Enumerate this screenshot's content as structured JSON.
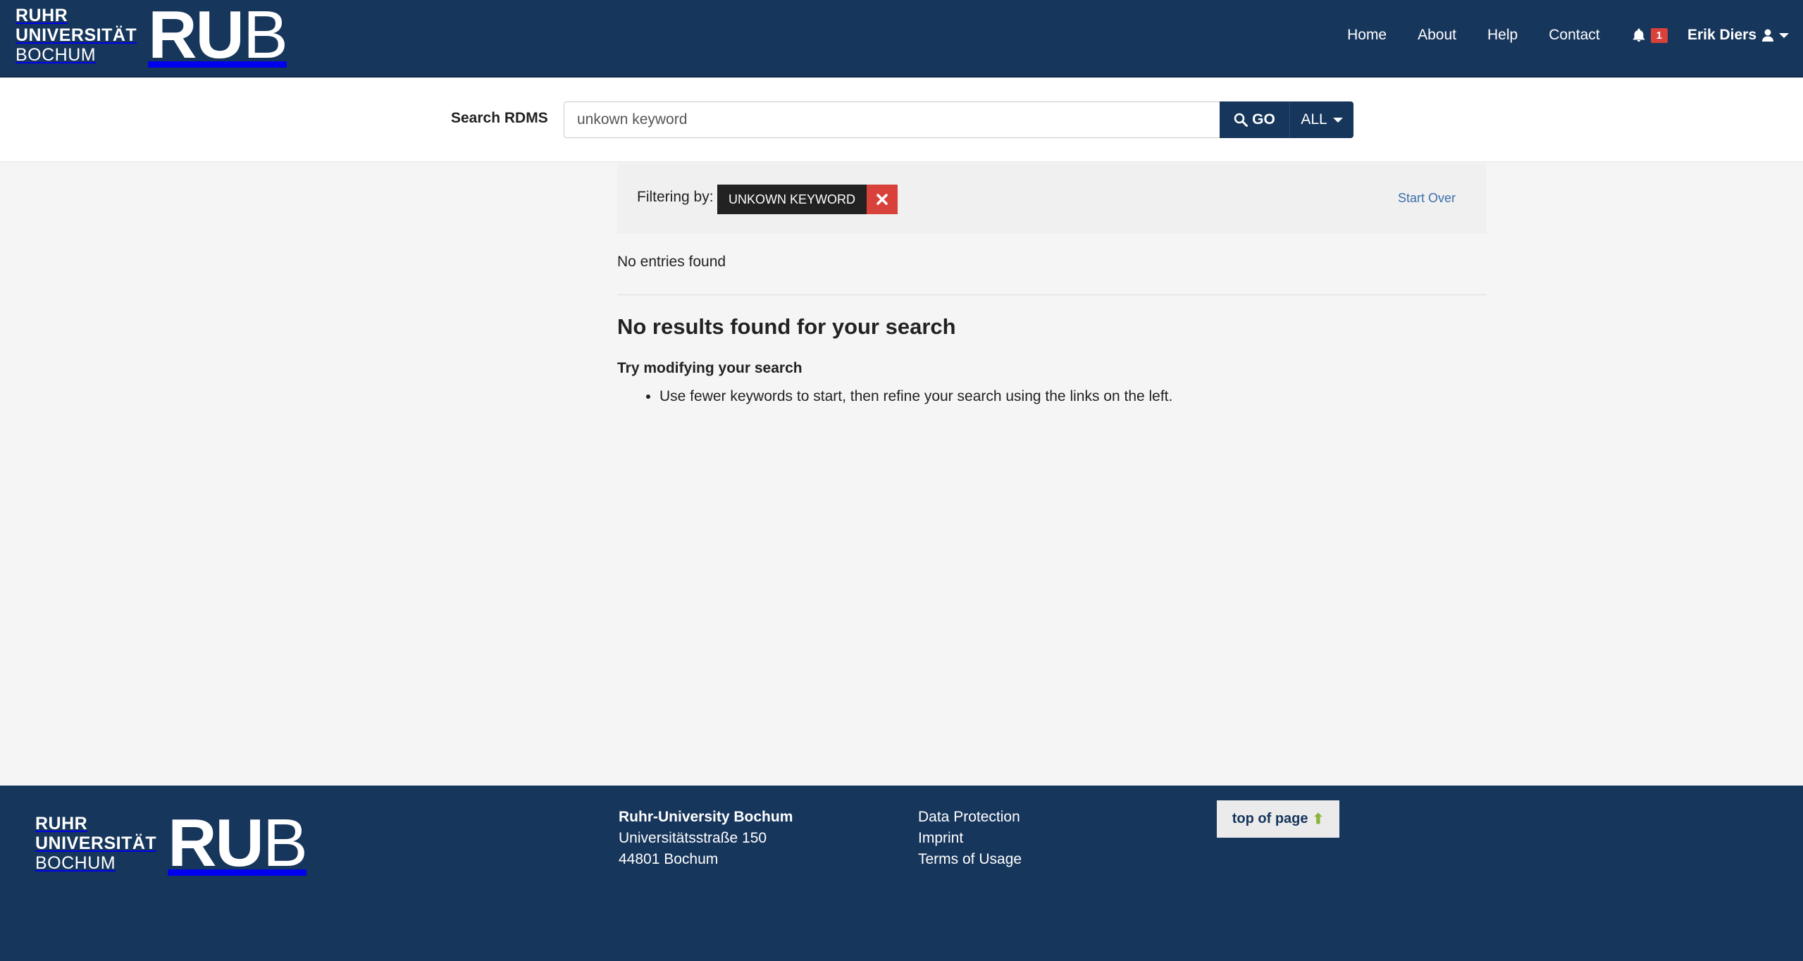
{
  "header": {
    "brand_line1": "RUHR",
    "brand_line2": "UNIVERSITÄT",
    "brand_line3": "BOCHUM",
    "brand_mark_ru": "RU",
    "brand_mark_b": "B",
    "nav": [
      "Home",
      "About",
      "Help",
      "Contact"
    ],
    "notification_count": "1",
    "user_name": "Erik Diers"
  },
  "search": {
    "label": "Search RDMS",
    "value": "unkown keyword",
    "go_label": "GO",
    "scope_label": "ALL"
  },
  "constraints": {
    "label": "Filtering by:",
    "filter_value": "UNKOWN KEYWORD",
    "start_over": "Start Over"
  },
  "results": {
    "entries_text": "No entries found",
    "heading": "No results found for your search",
    "subheading": "Try modifying your search",
    "tips": [
      "Use fewer keywords to start, then refine your search using the links on the left."
    ]
  },
  "footer": {
    "brand_line1": "RUHR",
    "brand_line2": "UNIVERSITÄT",
    "brand_line3": "BOCHUM",
    "brand_mark_ru": "RU",
    "brand_mark_b": "B",
    "org_name": "Ruhr-University Bochum",
    "street": "Universitätsstraße 150",
    "city": "44801 Bochum",
    "links": [
      "Data Protection",
      "Imprint",
      "Terms of Usage"
    ],
    "top_label": "top of page",
    "top_arrow": "⬆"
  },
  "colors": {
    "brand_blue": "#17365c",
    "danger_red": "#d9413b",
    "link_blue": "#3b6fa8",
    "accent_green": "#8cb43c"
  },
  "icons": [
    "bell-icon",
    "user-icon",
    "search-icon",
    "remove-icon",
    "chevron-down-icon"
  ]
}
